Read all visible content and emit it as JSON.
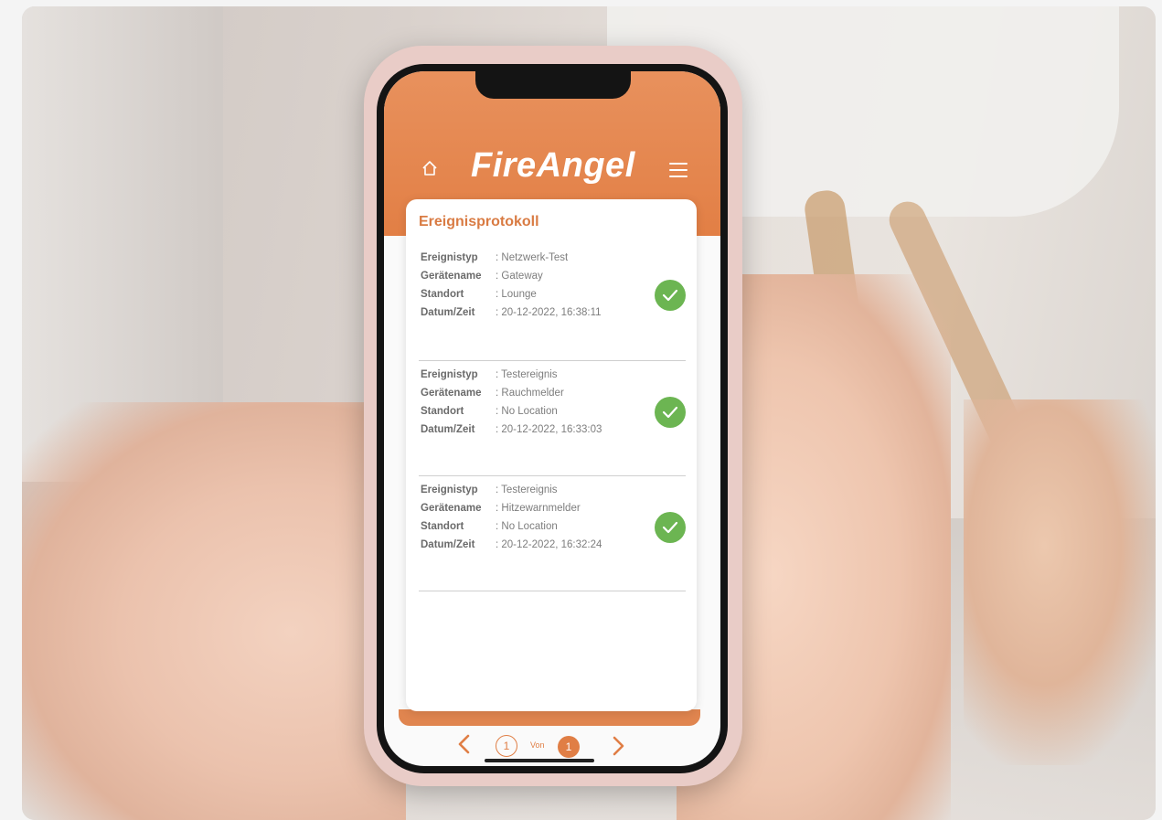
{
  "app": {
    "brand": "FireAngel",
    "accent_color": "#e2844a",
    "success_color": "#6cb552"
  },
  "header": {
    "home_icon": "home-icon",
    "menu_icon": "hamburger-menu-icon"
  },
  "card": {
    "title": "Ereignisprotokoll",
    "entries": [
      {
        "rows": [
          {
            "label": "Ereignistyp",
            "value": ": Netzwerk-Test"
          },
          {
            "label": "Gerätename",
            "value": ": Gateway"
          },
          {
            "label": "Standort",
            "value": ": Lounge"
          },
          {
            "label": "Datum/Zeit",
            "value": ": 20-12-2022, 16:38:11"
          }
        ],
        "status_icon": "check-icon"
      },
      {
        "rows": [
          {
            "label": "Ereignistyp",
            "value": ": Testereignis"
          },
          {
            "label": "Gerätename",
            "value": ": Rauchmelder"
          },
          {
            "label": "Standort",
            "value": ": No Location"
          },
          {
            "label": "Datum/Zeit",
            "value": ": 20-12-2022, 16:33:03"
          }
        ],
        "status_icon": "check-icon"
      },
      {
        "rows": [
          {
            "label": "Ereignistyp",
            "value": ": Testereignis"
          },
          {
            "label": "Gerätename",
            "value": ": Hitzewarnmelder"
          },
          {
            "label": "Standort",
            "value": ": No Location"
          },
          {
            "label": "Datum/Zeit",
            "value": ": 20-12-2022, 16:32:24"
          }
        ],
        "status_icon": "check-icon"
      }
    ]
  },
  "pagination": {
    "current": "1",
    "separator": "Von",
    "total": "1",
    "prev_icon": "chevron-left-icon",
    "next_icon": "chevron-right-icon"
  }
}
